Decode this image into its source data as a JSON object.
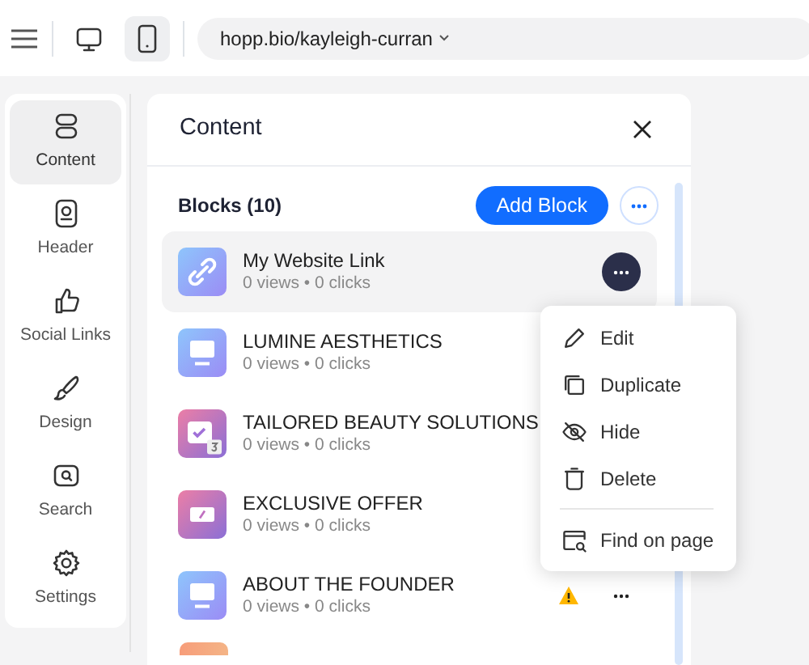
{
  "topbar": {
    "devices": [
      {
        "kind": "desktop",
        "selected": false
      },
      {
        "kind": "mobile",
        "selected": true
      }
    ],
    "url": "hopp.bio/kayleigh-curran"
  },
  "sidebar": {
    "items": [
      {
        "label": "Content",
        "kind": "stack",
        "selected": true
      },
      {
        "label": "Header",
        "kind": "header",
        "selected": false
      },
      {
        "label": "Social Links",
        "kind": "thumb",
        "selected": false
      },
      {
        "label": "Design",
        "kind": "brush",
        "selected": false
      },
      {
        "label": "Search",
        "kind": "search",
        "selected": false
      },
      {
        "label": "Settings",
        "kind": "gear",
        "selected": false
      }
    ]
  },
  "panel": {
    "title": "Content",
    "blocks_heading": "Blocks (10)",
    "add_button": "Add Block",
    "blocks": [
      {
        "title": "My Website Link",
        "stats": "0 views • 0 clicks",
        "kind": "link",
        "selected": true,
        "warning": false
      },
      {
        "title": "LUMINE AESTHETICS",
        "stats": "0 views • 0 clicks",
        "kind": "monitor",
        "selected": false,
        "warning": false
      },
      {
        "title": "TAILORED BEAUTY SOLUTIONS",
        "stats": "0 views • 0 clicks",
        "kind": "calendar",
        "selected": false,
        "warning": false
      },
      {
        "title": "EXCLUSIVE OFFER",
        "stats": "0 views • 0 clicks",
        "kind": "ticket",
        "selected": false,
        "warning": false
      },
      {
        "title": "ABOUT THE FOUNDER",
        "stats": "0 views • 0 clicks",
        "kind": "monitor",
        "selected": false,
        "warning": true
      }
    ]
  },
  "context_menu": {
    "items": [
      {
        "label": "Edit",
        "kind": "pencil",
        "divider_before": false
      },
      {
        "label": "Duplicate",
        "kind": "copy",
        "divider_before": false
      },
      {
        "label": "Hide",
        "kind": "eye-off",
        "divider_before": false
      },
      {
        "label": "Delete",
        "kind": "trash",
        "divider_before": false
      },
      {
        "label": "Find on page",
        "kind": "find",
        "divider_before": true
      }
    ]
  }
}
